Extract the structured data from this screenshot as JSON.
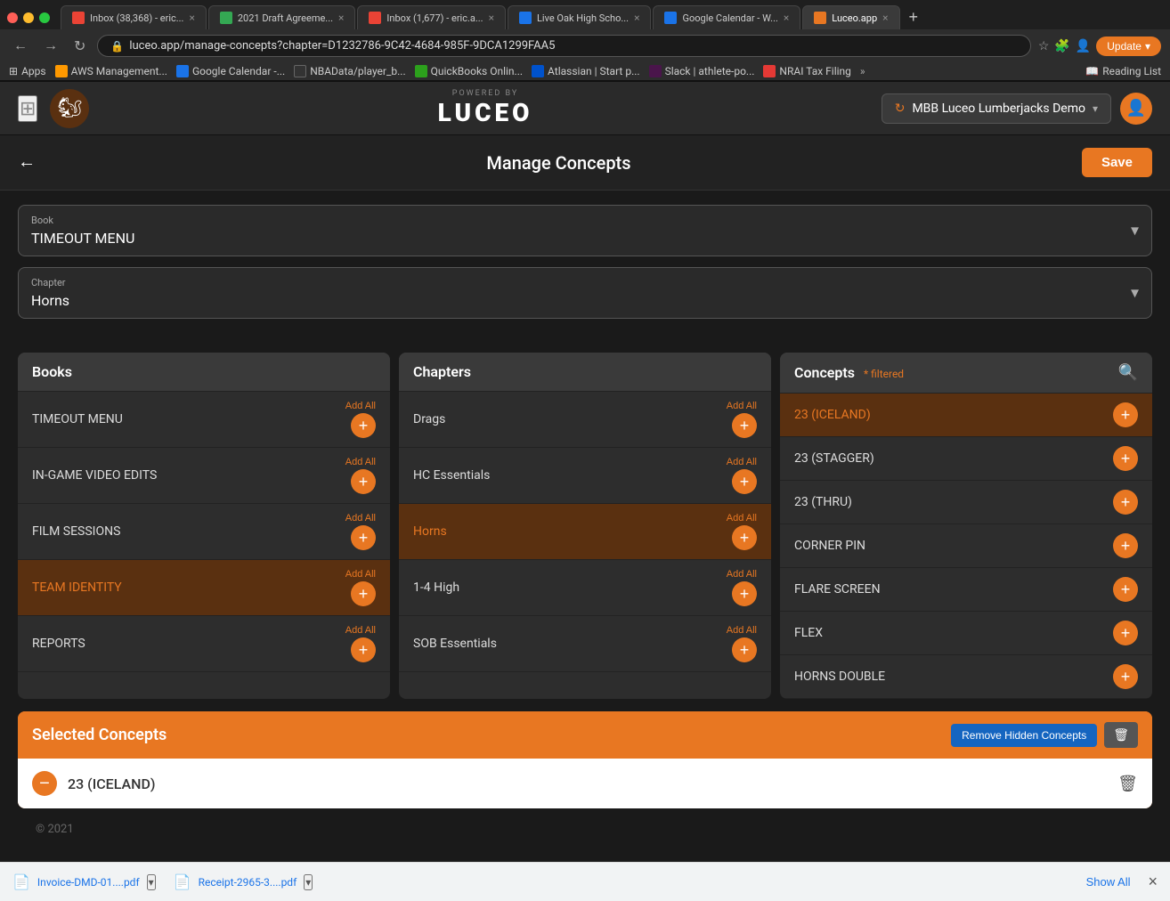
{
  "browser": {
    "tabs": [
      {
        "id": "tab1",
        "title": "Inbox (38,368) - eric...",
        "favicon_color": "#ea4335",
        "active": false
      },
      {
        "id": "tab2",
        "title": "2021 Draft Agreeme...",
        "favicon_color": "#34a853",
        "active": false
      },
      {
        "id": "tab3",
        "title": "Inbox (1,677) - eric.a...",
        "favicon_color": "#ea4335",
        "active": false
      },
      {
        "id": "tab4",
        "title": "Live Oak High Scho...",
        "favicon_color": "#1a73e8",
        "active": false
      },
      {
        "id": "tab5",
        "title": "Google Calendar - W...",
        "favicon_color": "#1a73e8",
        "active": false
      },
      {
        "id": "tab6",
        "title": "Luceo.app",
        "favicon_color": "#e87722",
        "active": true
      }
    ],
    "address": "luceo.app/manage-concepts?chapter=D1232786-9C42-4684-985F-9DCA1299FAA5",
    "bookmarks": [
      {
        "label": "Apps",
        "color": "#4285f4"
      },
      {
        "label": "AWS Management...",
        "color": "#ff9900"
      },
      {
        "label": "Google Calendar -...",
        "color": "#1a73e8"
      },
      {
        "label": "NBAData/player_b...",
        "color": "#333"
      },
      {
        "label": "QuickBooks Onlin...",
        "color": "#2ca01c"
      },
      {
        "label": "Atlassian | Start p...",
        "color": "#0052cc"
      },
      {
        "label": "Slack | athlete-po...",
        "color": "#4a154b"
      },
      {
        "label": "NRAI Tax Filing",
        "color": "#e53935"
      }
    ]
  },
  "app": {
    "logo": {
      "powered_by": "POWERED BY",
      "name": "LUCEO"
    },
    "team": "MBB Luceo Lumberjacks Demo",
    "update_btn": "Update"
  },
  "page": {
    "title": "Manage Concepts",
    "save_btn": "Save",
    "back_icon": "←"
  },
  "book_field": {
    "label": "Book",
    "value": "TIMEOUT MENU"
  },
  "chapter_field": {
    "label": "Chapter",
    "value": "Horns"
  },
  "books_panel": {
    "title": "Books",
    "items": [
      {
        "label": "TIMEOUT MENU",
        "active": false
      },
      {
        "label": "IN-GAME VIDEO EDITS",
        "active": false
      },
      {
        "label": "FILM SESSIONS",
        "active": false
      },
      {
        "label": "TEAM IDENTITY",
        "active": true
      },
      {
        "label": "REPORTS",
        "active": false
      }
    ],
    "add_all_label": "Add All"
  },
  "chapters_panel": {
    "title": "Chapters",
    "items": [
      {
        "label": "Drags",
        "active": false
      },
      {
        "label": "HC Essentials",
        "active": false
      },
      {
        "label": "Horns",
        "active": true
      },
      {
        "label": "1-4 High",
        "active": false
      },
      {
        "label": "SOB Essentials",
        "active": false
      }
    ],
    "add_all_label": "Add All"
  },
  "concepts_panel": {
    "title": "Concepts",
    "filtered_badge": "* filtered",
    "items": [
      {
        "label": "23 (ICELAND)",
        "active": true
      },
      {
        "label": "23 (STAGGER)",
        "active": false
      },
      {
        "label": "23 (THRU)",
        "active": false
      },
      {
        "label": "CORNER PIN",
        "active": false
      },
      {
        "label": "FLARE SCREEN",
        "active": false
      },
      {
        "label": "FLEX",
        "active": false
      },
      {
        "label": "HORNS DOUBLE",
        "active": false
      }
    ]
  },
  "selected_section": {
    "title": "Selected Concepts",
    "remove_hidden_btn": "Remove Hidden Concepts",
    "items": [
      {
        "label": "23 (ICELAND)"
      }
    ]
  },
  "footer": {
    "copyright": "© 2021"
  },
  "download_bar": {
    "files": [
      {
        "name": "Invoice-DMD-01....pdf",
        "icon": "📄"
      },
      {
        "name": "Receipt-2965-3....pdf",
        "icon": "📄"
      }
    ],
    "show_all": "Show All"
  }
}
